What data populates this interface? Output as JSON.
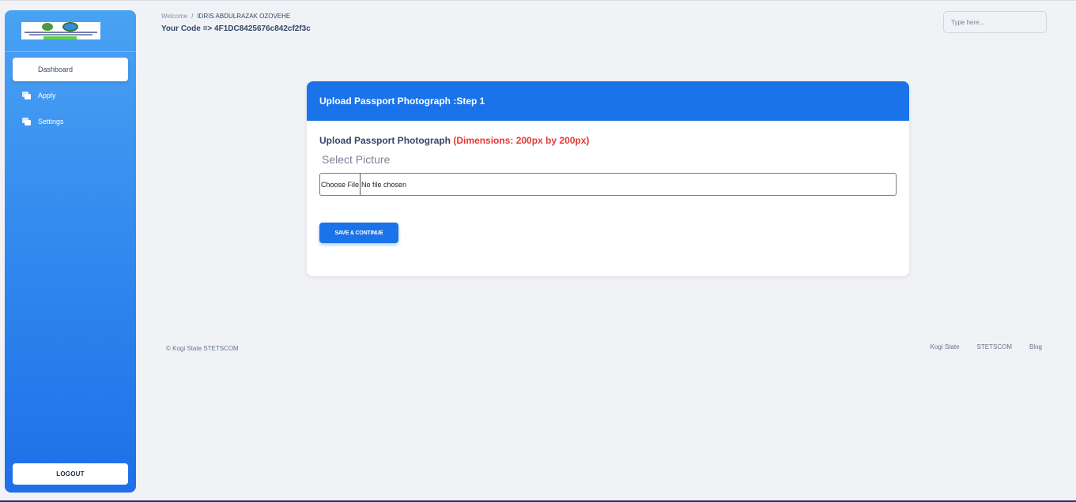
{
  "sidebar": {
    "items": [
      {
        "label": "Dashboard",
        "icon": "none"
      },
      {
        "label": "Apply",
        "icon": "copy-icon"
      },
      {
        "label": "Settings",
        "icon": "copy-icon"
      }
    ],
    "logout_label": "LOGOUT"
  },
  "header": {
    "breadcrumb_root": "Welcome",
    "breadcrumb_sep": "/",
    "user_name": "IDRIS ABDULRAZAK OZOVEHE",
    "code_line": "Your Code => 4F1DC8425676c842cf2f3c",
    "search_placeholder": "Type here..."
  },
  "card": {
    "title": "Upload Passport Photograph :Step 1",
    "upload_label": "Upload Passport Photograph",
    "dimensions_note": "(Dimensions: 200px by 200px)",
    "select_picture": "Select Picture",
    "file_button": "Choose File",
    "file_status": "No file chosen",
    "save_button": "SAVE & CONTINUE"
  },
  "footer": {
    "copyright": "© Kogi State STETSCOM",
    "links": [
      "Kogi State",
      "STETSCOM",
      "Blog"
    ]
  },
  "colors": {
    "primary": "#1a73e8",
    "danger": "#e53935",
    "sidebar_top": "#4aa2f3",
    "sidebar_bottom": "#1f6fe8"
  }
}
